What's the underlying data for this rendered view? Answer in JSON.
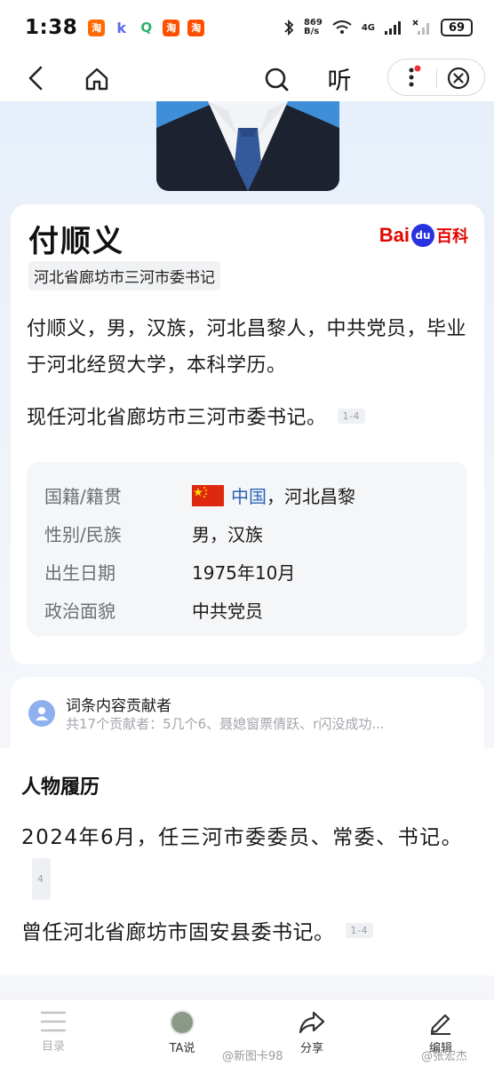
{
  "status_bar": {
    "time": "1:38",
    "net_speed_value": "869",
    "net_speed_unit": "B/s",
    "network": "4G",
    "battery": "69",
    "notifications": [
      "淘",
      "k",
      "Q",
      "淘",
      "淘"
    ]
  },
  "nav": {
    "listen_label": "听"
  },
  "profile": {
    "name": "付顺义",
    "logo_text_bai": "Bai",
    "logo_text_du": "du",
    "logo_text_baike": "百科",
    "title_tag": "河北省廊坊市三河市委书记",
    "summary": "付顺义，男，汉族，河北昌黎人，中共党员，毕业于河北经贸大学，本科学历。",
    "current_position": "现任河北省廊坊市三河市委书记。",
    "current_ref": "1-4",
    "info": [
      {
        "key": "国籍/籍贯",
        "link": "中国",
        "value": "，河北昌黎"
      },
      {
        "key": "性别/民族",
        "value": "男，汉族"
      },
      {
        "key": "出生日期",
        "value": "1975年10月"
      },
      {
        "key": "政治面貌",
        "value": "中共党员"
      }
    ]
  },
  "contributors": {
    "title": "词条内容贡献者",
    "list": "共17个贡献者：5几个6、聂媳窗票倩跃、r闪没成功..."
  },
  "career": {
    "title": "人物履历",
    "entry1": "2024年6月，任三河市委委员、常委、书记。",
    "entry1_ref": "4",
    "entry2": "曾任河北省廊坊市固安县委书记。",
    "entry2_ref": "1-4"
  },
  "bottom_bar": {
    "tabs": [
      "目录",
      "TA说",
      "分享",
      "编辑"
    ]
  },
  "watermark": {
    "left": "@新图卡98",
    "right": "@张宏杰"
  },
  "colors": {
    "flag_red": "#de2910",
    "baidu_red": "#e10601",
    "baidu_blue": "#2932e1",
    "link_blue": "#2a63b8"
  }
}
